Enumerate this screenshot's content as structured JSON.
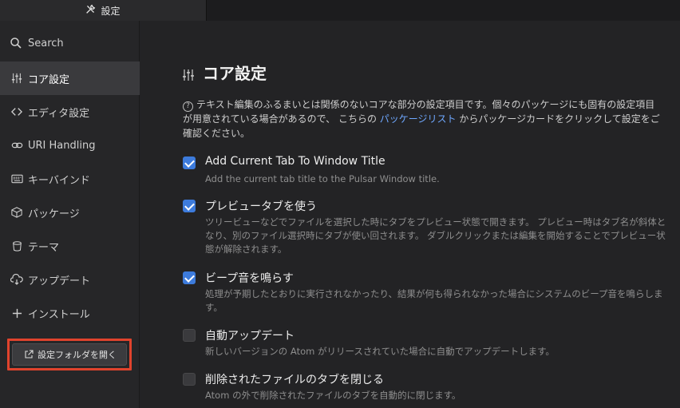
{
  "tab": {
    "label": "設定",
    "icon": "tools-icon"
  },
  "sidebar": {
    "search_label": "Search",
    "items": [
      {
        "label": "コア設定",
        "icon": "sliders-icon",
        "active": true
      },
      {
        "label": "エディタ設定",
        "icon": "code-icon",
        "active": false
      },
      {
        "label": "URI Handling",
        "icon": "link-icon",
        "active": false
      },
      {
        "label": "キーバインド",
        "icon": "keyboard-icon",
        "active": false
      },
      {
        "label": "パッケージ",
        "icon": "package-icon",
        "active": false
      },
      {
        "label": "テーマ",
        "icon": "paintcan-icon",
        "active": false
      },
      {
        "label": "アップデート",
        "icon": "cloud-download-icon",
        "active": false
      },
      {
        "label": "インストール",
        "icon": "plus-icon",
        "active": false
      }
    ],
    "open_folder_label": "設定フォルダを開く"
  },
  "main": {
    "title": "コア設定",
    "description_before": "テキスト編集のふるまいとは関係のないコアな部分の設定項目です。個々のパッケージにも固有の設定項目が用意されている場合があるので、 こちらの ",
    "description_link": "パッケージリスト",
    "description_after": " からパッケージカードをクリックして設定をご確認ください。",
    "settings": [
      {
        "title": "Add Current Tab To Window Title",
        "description": "Add the current tab title to the Pulsar Window title.",
        "checked": true
      },
      {
        "title": "プレビュータブを使う",
        "description": "ツリービューなどでファイルを選択した時にタブをプレビュー状態で開きます。 プレビュー時はタブ名が斜体となり、別のファイル選択時にタブが使い回されます。 ダブルクリックまたは編集を開始することでプレビュー状態が解除されます。",
        "checked": true
      },
      {
        "title": "ビープ音を鳴らす",
        "description": "処理が予期したとおりに実行されなかったり、結果が何も得られなかった場合にシステムのビープ音を鳴らします。",
        "checked": true
      },
      {
        "title": "自動アップデート",
        "description": "新しいバージョンの Atom がリリースされていた場合に自動でアップデートします。",
        "checked": false
      },
      {
        "title": "削除されたファイルのタブを閉じる",
        "description": "Atom の外で削除されたファイルのタブを自動的に閉じます。",
        "checked": false
      }
    ]
  },
  "colors": {
    "accent": "#3d7bdc",
    "highlight_border": "#e0432d",
    "link": "#6fa8ff"
  }
}
